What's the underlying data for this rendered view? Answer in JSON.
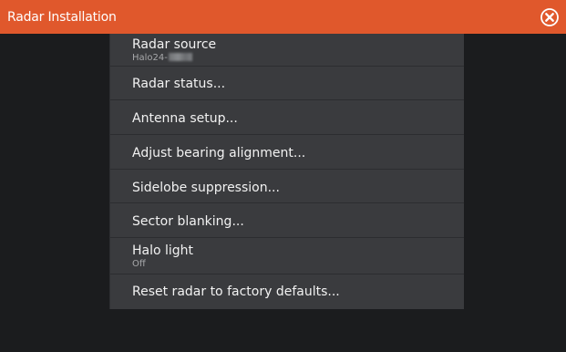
{
  "header": {
    "title": "Radar Installation",
    "close_icon": "close-circle-icon",
    "accent_color": "#e0582c"
  },
  "menu": {
    "radar_source": {
      "label": "Radar source",
      "value": "Halo24-"
    },
    "radar_status": {
      "label": "Radar status..."
    },
    "antenna_setup": {
      "label": "Antenna setup..."
    },
    "adjust_bearing": {
      "label": "Adjust bearing alignment..."
    },
    "sidelobe": {
      "label": "Sidelobe suppression..."
    },
    "sector_blanking": {
      "label": "Sector blanking..."
    },
    "halo_light": {
      "label": "Halo light",
      "value": "Off"
    },
    "reset": {
      "label": "Reset radar to factory defaults..."
    }
  }
}
